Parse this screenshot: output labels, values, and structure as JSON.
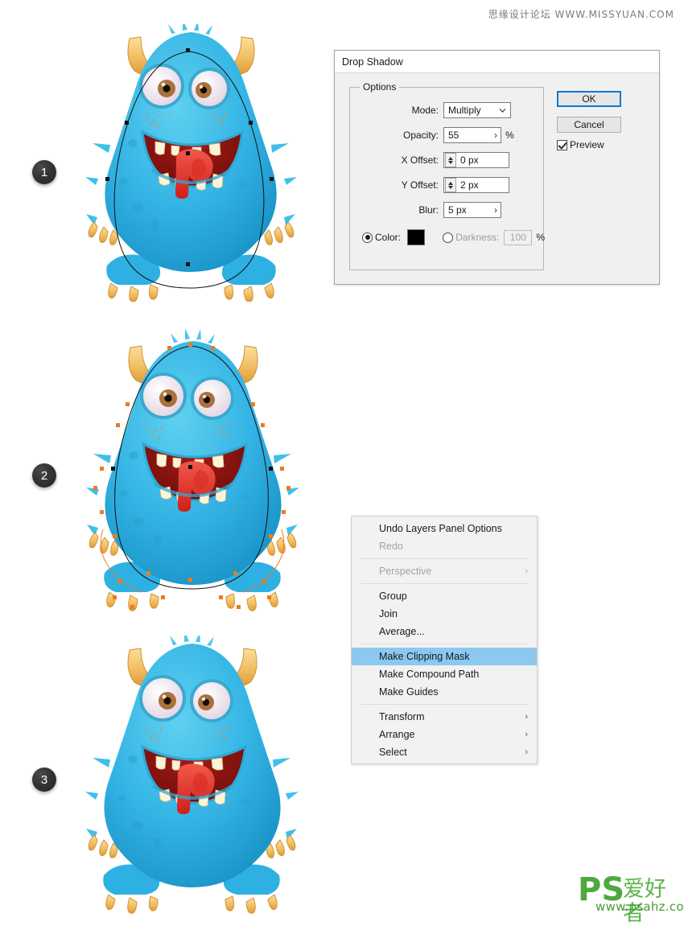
{
  "watermarks": {
    "top": "思缘设计论坛 WWW.MISSYUAN.COM",
    "logo_ps": "PS",
    "logo_cn": "爱好者",
    "logo_url": "www.psahz.com"
  },
  "steps": [
    {
      "number": "1",
      "caption": ""
    },
    {
      "number": "2",
      "caption": ""
    },
    {
      "number": "3",
      "caption": ""
    }
  ],
  "dialog": {
    "title": "Drop Shadow",
    "group_label": "Options",
    "fields": {
      "mode": {
        "label": "Mode:",
        "value": "Multiply"
      },
      "opacity": {
        "label": "Opacity:",
        "value": "55",
        "unit": "%"
      },
      "x_offset": {
        "label": "X Offset:",
        "value": "0 px"
      },
      "y_offset": {
        "label": "Y Offset:",
        "value": "2 px"
      },
      "blur": {
        "label": "Blur:",
        "value": "5 px"
      },
      "color": {
        "label": "Color:",
        "swatch": "#000000",
        "selected": true
      },
      "darkness": {
        "label": "Darkness:",
        "value": "100",
        "unit": "%",
        "selected": false
      }
    },
    "buttons": {
      "ok": "OK",
      "cancel": "Cancel"
    },
    "preview": {
      "label": "Preview",
      "checked": true
    },
    "accent_color": "#0a78d2"
  },
  "context_menu": {
    "highlight_color": "#8cc8ef",
    "items": [
      {
        "label": "Undo Layers Panel Options",
        "disabled": false,
        "submenu": false,
        "highlight": false
      },
      {
        "label": "Redo",
        "disabled": true,
        "submenu": false,
        "highlight": false
      },
      {
        "separator": true
      },
      {
        "label": "Perspective",
        "disabled": true,
        "submenu": true,
        "highlight": false
      },
      {
        "separator": true
      },
      {
        "label": "Group",
        "disabled": false,
        "submenu": false,
        "highlight": false
      },
      {
        "label": "Join",
        "disabled": false,
        "submenu": false,
        "highlight": false
      },
      {
        "label": "Average...",
        "disabled": false,
        "submenu": false,
        "highlight": false
      },
      {
        "separator": true
      },
      {
        "label": "Make Clipping Mask",
        "disabled": false,
        "submenu": false,
        "highlight": true
      },
      {
        "label": "Make Compound Path",
        "disabled": false,
        "submenu": false,
        "highlight": false
      },
      {
        "label": "Make Guides",
        "disabled": false,
        "submenu": false,
        "highlight": false
      },
      {
        "separator": true
      },
      {
        "label": "Transform",
        "disabled": false,
        "submenu": true,
        "highlight": false
      },
      {
        "label": "Arrange",
        "disabled": false,
        "submenu": true,
        "highlight": false
      },
      {
        "label": "Select",
        "disabled": false,
        "submenu": true,
        "highlight": false
      }
    ],
    "submenu_glyph": "›"
  },
  "artwork": {
    "description": "blue furry cartoon monster",
    "body_color": "#35b5e5",
    "body_color_dark": "#1f9ccd",
    "horn_color": "#f2c069",
    "mouth_color": "#8c1410",
    "tongue_color": "#e8362c",
    "tooth_color": "#fdf3d9",
    "eye_iris_color": "#a9713c",
    "path_color_1": "#000000",
    "path_color_2": "#f07a1a"
  }
}
